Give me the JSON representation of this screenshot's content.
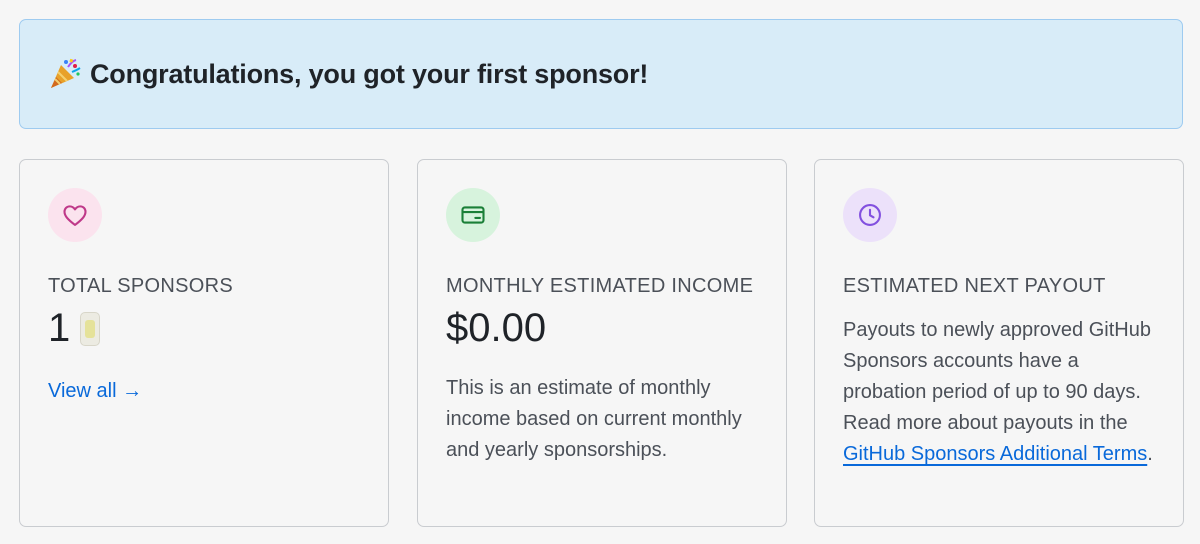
{
  "banner": {
    "text": "Congratulations, you got your first sponsor!",
    "icon": "party-popper-icon"
  },
  "cards": {
    "total_sponsors": {
      "icon": "heart-icon",
      "label": "TOTAL SPONSORS",
      "value": "1",
      "link": "View all →"
    },
    "monthly_income": {
      "icon": "credit-card-icon",
      "label": "MONTHLY ESTIMATED INCOME",
      "value": "$0.00",
      "description": "This is an estimate of monthly income based on current monthly and yearly sponsorships."
    },
    "next_payout": {
      "icon": "clock-icon",
      "label": "ESTIMATED NEXT PAYOUT",
      "description_prefix": "Payouts to newly approved GitHub Sponsors accounts have a probation period of up to 90 days. Read more about payouts in the ",
      "link": "GitHub Sponsors Additional Terms",
      "description_suffix": "."
    }
  },
  "colors": {
    "banner_bg": "#d8ecf8",
    "banner_border": "#9ecbf0",
    "link": "#0969da",
    "heart": "#bf3989",
    "card": "#1a7f37",
    "clock": "#8250df"
  }
}
